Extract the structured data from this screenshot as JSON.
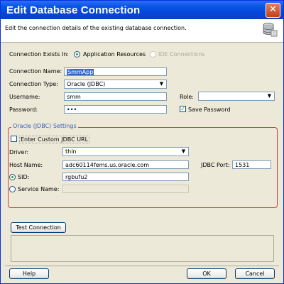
{
  "window": {
    "title": "Edit Database Connection",
    "close_glyph": "✕"
  },
  "header": {
    "description": "Edit the connection details of the existing database connection.",
    "icon": "database-icon"
  },
  "connection_exists_in": {
    "label": "Connection Exists In:",
    "options": [
      {
        "label": "Application Resources",
        "selected": true,
        "enabled": true
      },
      {
        "label": "IDE Connections",
        "selected": false,
        "enabled": false
      }
    ]
  },
  "form": {
    "connection_name_label": "Connection Name:",
    "connection_name_value": "SmmApp",
    "connection_type_label": "Connection Type:",
    "connection_type_value": "Oracle (JDBC)",
    "username_label": "Username:",
    "username_value": "smm",
    "password_label": "Password:",
    "password_value": "•••",
    "role_label": "Role:",
    "role_value": "",
    "save_password_label": "Save Password",
    "save_password_checked": true
  },
  "oracle": {
    "group_title": "Oracle (JDBC) Settings",
    "custom_url_label": "Enter Custom JDBC URL",
    "custom_url_checked": false,
    "driver_label": "Driver:",
    "driver_value": "thin",
    "host_label": "Host Name:",
    "host_value": "adc60114fems.us.oracle.com",
    "port_label": "JDBC Port:",
    "port_value": "1531",
    "sid_label": "SID:",
    "sid_value": "rgbufu2",
    "service_label": "Service Name:",
    "service_value": ""
  },
  "buttons": {
    "test_connection": "Test Connection",
    "help": "Help",
    "ok": "OK",
    "cancel": "Cancel"
  },
  "colors": {
    "titlebar": "#0a55e6",
    "group_border": "#cf3a3a",
    "selection": "#316ac5"
  }
}
